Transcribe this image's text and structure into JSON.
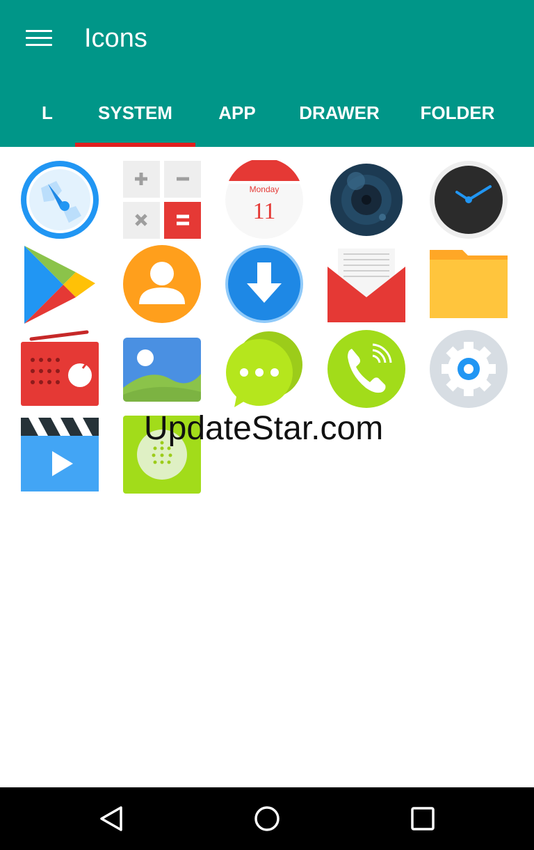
{
  "appbar": {
    "title": "Icons",
    "menu_icon": "hamburger-menu-icon",
    "background": "#009688"
  },
  "tabs": [
    {
      "label": "L",
      "selected": false
    },
    {
      "label": "SYSTEM",
      "selected": true
    },
    {
      "label": "APP",
      "selected": false
    },
    {
      "label": "DRAWER",
      "selected": false
    },
    {
      "label": "FOLDER",
      "selected": false
    }
  ],
  "tab_indicator_color": "#e11e1e",
  "calendar": {
    "day_name": "Monday",
    "day_number": "11"
  },
  "icons": [
    "browser-compass-icon",
    "calculator-icon",
    "calendar-icon",
    "camera-icon",
    "clock-icon",
    "play-store-icon",
    "contacts-icon",
    "downloads-icon",
    "email-icon",
    "file-manager-icon",
    "radio-icon",
    "gallery-icon",
    "messaging-icon",
    "phone-icon",
    "settings-icon",
    "video-player-icon",
    "sound-recorder-icon"
  ],
  "watermark": "UpdateStar.com",
  "navbar": {
    "back_icon": "back-triangle-icon",
    "home_icon": "home-circle-icon",
    "recents_icon": "recents-square-icon"
  }
}
